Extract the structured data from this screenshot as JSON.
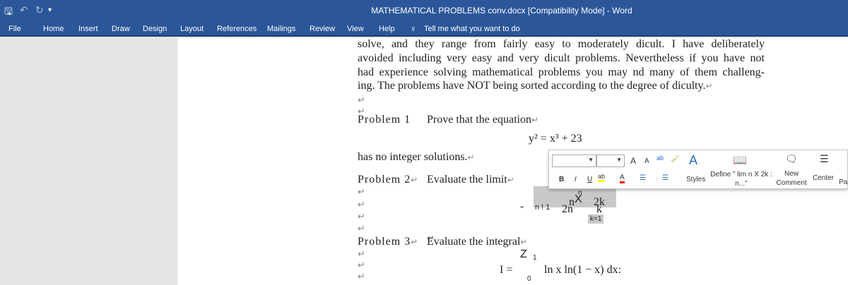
{
  "window": {
    "title": "MATHEMATICAL PROBLEMS conv.docx [Compatibility Mode]  -  Word"
  },
  "quick_access": {
    "save": "save-icon",
    "undo": "undo-icon",
    "redo": "redo-icon",
    "customize": "customize-icon"
  },
  "ribbon_tabs": [
    "File",
    "Home",
    "Insert",
    "Draw",
    "Design",
    "Layout",
    "References",
    "Mailings",
    "Review",
    "View",
    "Help"
  ],
  "tell_me": "Tell me what you want to do",
  "document": {
    "para1": [
      "solve, and they range from fairly easy to moderately dicult. I have deliberately",
      "avoided including very easy and very dicult problems. Nevertheless if you have not",
      "had experience solving mathematical problems you may nd many of them challeng-",
      "ing. The problems have NOT being sorted according to the degree of diculty."
    ],
    "p1_label": "Problem 1",
    "p1_text": "Prove that the equation",
    "p1_eq": "y² = x³ + 23",
    "p1_tail": "has no integer solutions.",
    "p2_label": "Problem 2",
    "p2_text": "Evaluate the limit",
    "p2_eq": {
      "minus": "-",
      "lim": "n ! 1",
      "n": "n",
      "two_n": "2n",
      "X": "X",
      "sup_n": "n",
      "two_k": "2k",
      "k": "k",
      "k1": "k=1"
    },
    "p3_label": "Problem 3",
    "p3_text": "Evaluate the integral",
    "p3_eq": {
      "Z": "Z",
      "upper": "1",
      "lhs": "I =",
      "body": "ln x ln(1 −  x) dx:",
      "lower": "0"
    }
  },
  "mini_toolbar": {
    "grow": "A",
    "shrink": "A",
    "bold": "B",
    "italic": "I",
    "underline": "U",
    "styles": "Styles",
    "define": "Define \" lim n X 2k : n...\"",
    "new_comment": "New Comment",
    "center": "Center",
    "para": "Para",
    "highlight_color": "#ffff00",
    "font_color": "#ff0000"
  }
}
